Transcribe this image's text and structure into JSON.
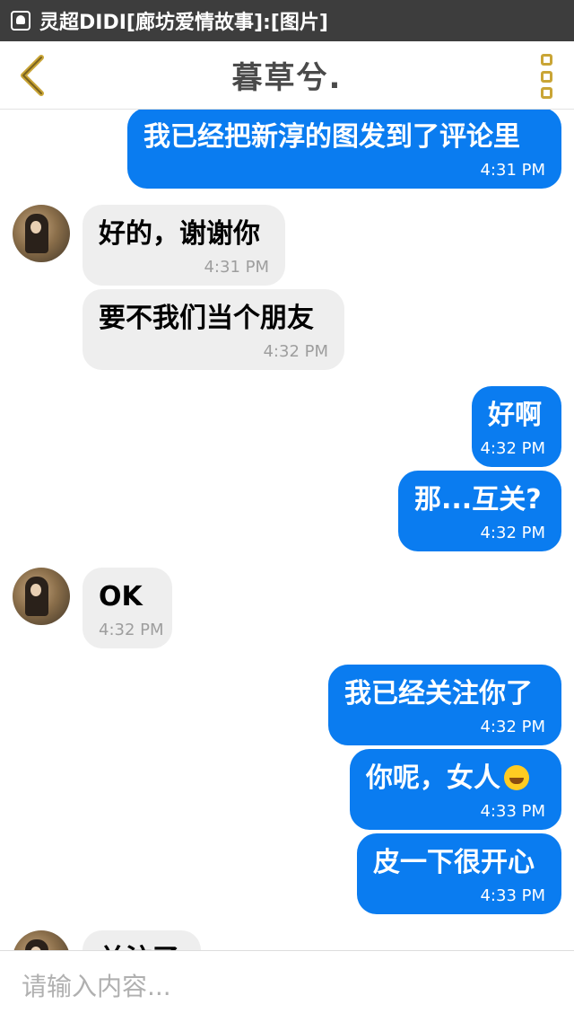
{
  "status_bar": {
    "notification_text": "灵超DIDI[廊坊爱情故事]:[图片]"
  },
  "header": {
    "title": "暮草兮."
  },
  "messages": [
    {
      "side": "out",
      "text": "我已经把新淳的图发到了评论里",
      "time": "4:31 PM"
    },
    {
      "side": "in",
      "text": "好的，谢谢你",
      "time": "4:31 PM"
    },
    {
      "side": "in",
      "text": "要不我们当个朋友",
      "time": "4:32 PM"
    },
    {
      "side": "out",
      "text": "好啊",
      "time": "4:32 PM"
    },
    {
      "side": "out",
      "text": "那...互关?",
      "time": "4:32 PM"
    },
    {
      "side": "in",
      "text": "OK",
      "time": "4:32 PM"
    },
    {
      "side": "out",
      "text": "我已经关注你了",
      "time": "4:32 PM"
    },
    {
      "side": "out",
      "text": "你呢，女人",
      "emoji": "laughing-tears-emoji",
      "time": "4:33 PM"
    },
    {
      "side": "out",
      "text": "皮一下很开心",
      "time": "4:33 PM"
    },
    {
      "side": "in",
      "text": "关注了",
      "time": ""
    }
  ],
  "input": {
    "placeholder": "请输入内容..."
  },
  "colors": {
    "outgoing": "#0a7cf0",
    "incoming": "#eeeeee",
    "accent": "#c9a536"
  }
}
